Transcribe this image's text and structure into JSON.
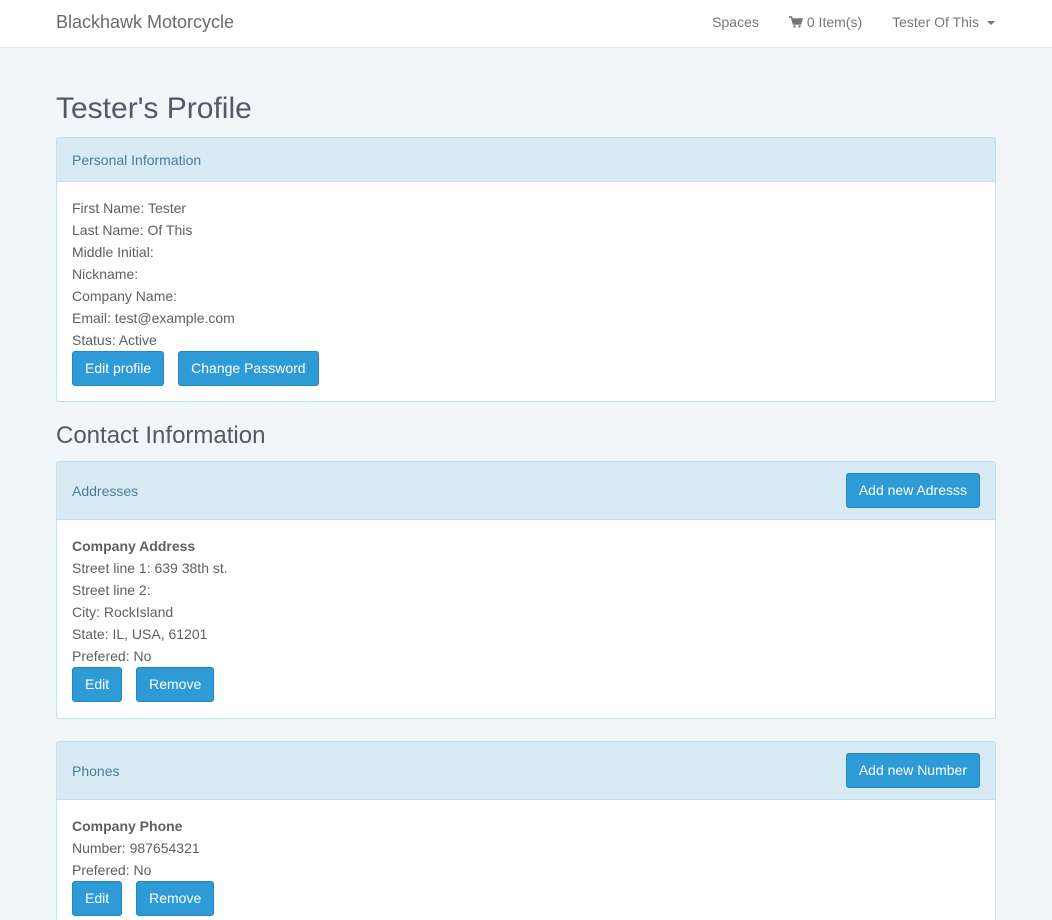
{
  "navbar": {
    "brand": "Blackhawk Motorcycle",
    "spaces": "Spaces",
    "cart": "0 Item(s)",
    "user": "Tester Of This"
  },
  "page_title": "Tester's Profile",
  "personal": {
    "heading": "Personal Information",
    "lines": [
      "First Name: Tester",
      "Last Name: Of This",
      "Middle Initial:",
      "Nickname:",
      "Company Name:",
      "Email: test@example.com",
      "Status: Active"
    ],
    "edit_label": "Edit profile",
    "password_label": "Change Password"
  },
  "contact_title": "Contact Information",
  "addresses": {
    "heading": "Addresses",
    "add_label": "Add new Adresss",
    "title": "Company Address",
    "lines": [
      "Street line 1: 639 38th st.",
      "Street line 2:",
      "City: RockIsland",
      "State: IL, USA, 61201",
      "Prefered: No"
    ],
    "edit_label": "Edit",
    "remove_label": "Remove"
  },
  "phones": {
    "heading": "Phones",
    "add_label": "Add new Number",
    "title": "Company Phone",
    "lines": [
      "Number: 987654321",
      "Prefered: No"
    ],
    "edit_label": "Edit",
    "remove_label": "Remove"
  }
}
